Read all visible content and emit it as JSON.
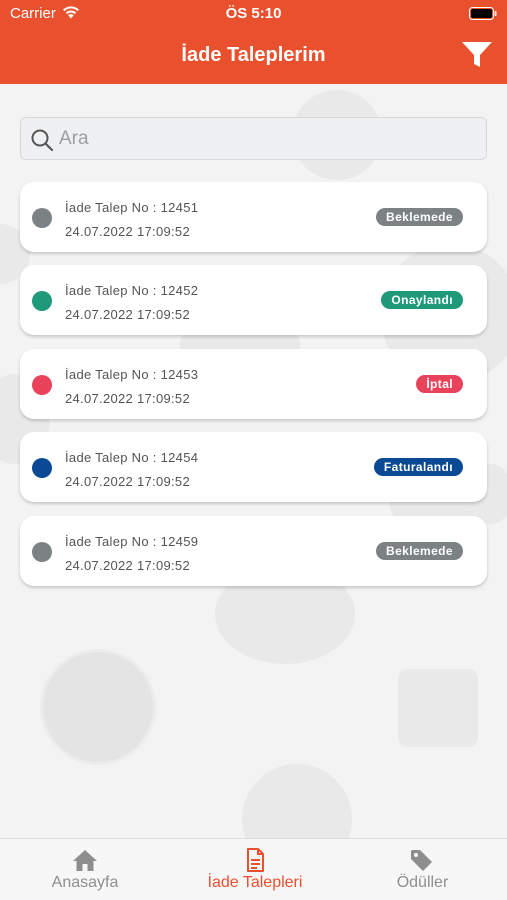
{
  "status_bar": {
    "carrier": "Carrier",
    "time": "ÖS 5:10"
  },
  "header": {
    "title": "İade Taleplerim"
  },
  "search": {
    "placeholder": "Ara"
  },
  "requests": [
    {
      "label": "İade Talep No : 12451",
      "date": "24.07.2022 17:09:52",
      "status": "Beklemede",
      "color": "#7c8283"
    },
    {
      "label": "İade Talep No : 12452",
      "date": "24.07.2022 17:09:52",
      "status": "Onaylandı",
      "color": "#1e9a7b"
    },
    {
      "label": "İade Talep No : 12453",
      "date": "24.07.2022 17:09:52",
      "status": "İptal",
      "color": "#e8435b"
    },
    {
      "label": "İade Talep No : 12454",
      "date": "24.07.2022 17:09:52",
      "status": "Faturalandı",
      "color": "#0a4a94"
    },
    {
      "label": "İade Talep No : 12459",
      "date": "24.07.2022 17:09:52",
      "status": "Beklemede",
      "color": "#7c8283"
    }
  ],
  "tabs": [
    {
      "label": "Anasayfa",
      "icon": "home-icon",
      "active": false
    },
    {
      "label": "İade Talepleri",
      "icon": "document-icon",
      "active": true
    },
    {
      "label": "Ödüller",
      "icon": "tag-icon",
      "active": false
    }
  ],
  "colors": {
    "accent": "#e9502e",
    "inactive": "#8e8e8e"
  }
}
